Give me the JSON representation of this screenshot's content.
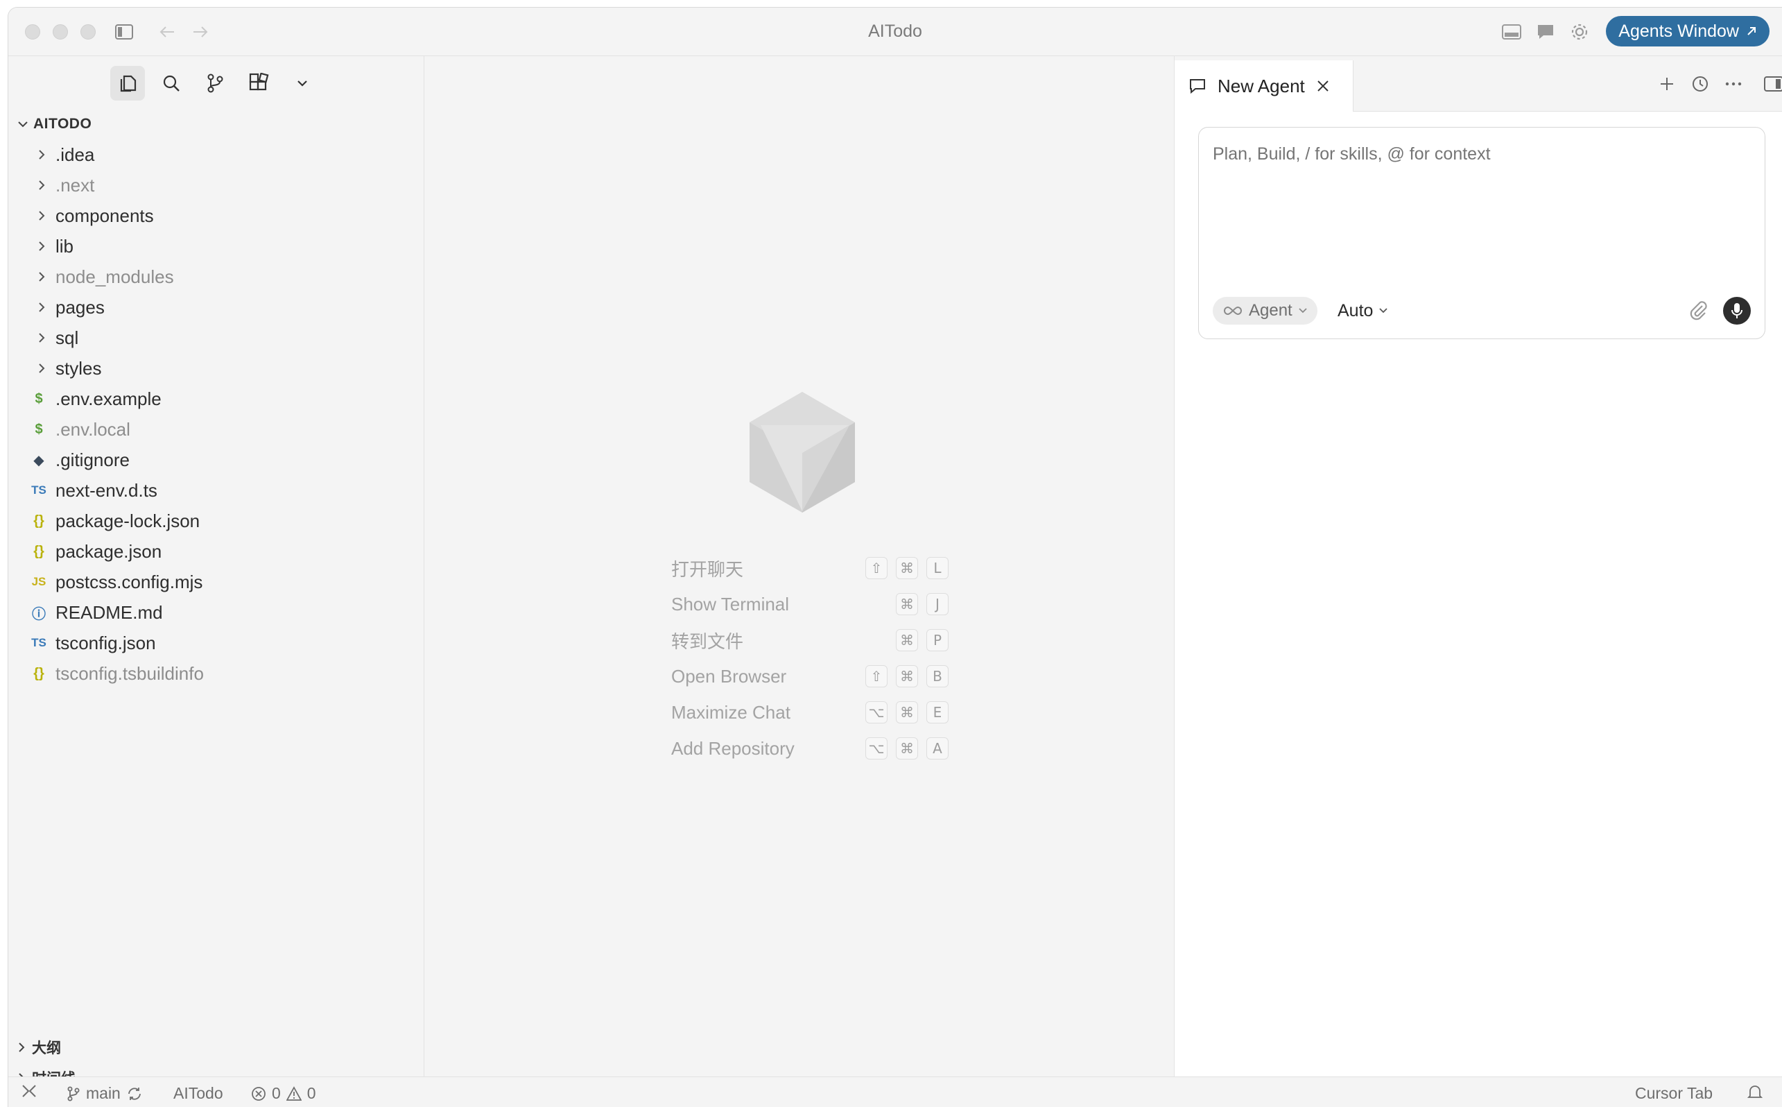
{
  "window": {
    "title": "AITodo"
  },
  "titlebar": {
    "agents_button": "Agents Window"
  },
  "explorer": {
    "root": "AITODO",
    "items": [
      {
        "label": ".idea",
        "kind": "folder",
        "dim": false
      },
      {
        "label": ".next",
        "kind": "folder",
        "dim": true
      },
      {
        "label": "components",
        "kind": "folder",
        "dim": false
      },
      {
        "label": "lib",
        "kind": "folder",
        "dim": false
      },
      {
        "label": "node_modules",
        "kind": "folder",
        "dim": true
      },
      {
        "label": "pages",
        "kind": "folder",
        "dim": false
      },
      {
        "label": "sql",
        "kind": "folder",
        "dim": false
      },
      {
        "label": "styles",
        "kind": "folder",
        "dim": false
      },
      {
        "label": ".env.example",
        "kind": "file",
        "icon": "$",
        "icon_color": "#5a9e3a",
        "dim": false
      },
      {
        "label": ".env.local",
        "kind": "file",
        "icon": "$",
        "icon_color": "#5a9e3a",
        "dim": true
      },
      {
        "label": ".gitignore",
        "kind": "file",
        "icon": "◆",
        "icon_color": "#3b4a5c",
        "dim": false
      },
      {
        "label": "next-env.d.ts",
        "kind": "file",
        "icon": "TS",
        "icon_color": "#3a7ab8",
        "dim": false
      },
      {
        "label": "package-lock.json",
        "kind": "file",
        "icon": "{}",
        "icon_color": "#b9b20b",
        "dim": false
      },
      {
        "label": "package.json",
        "kind": "file",
        "icon": "{}",
        "icon_color": "#b9b20b",
        "dim": false
      },
      {
        "label": "postcss.config.mjs",
        "kind": "file",
        "icon": "JS",
        "icon_color": "#c8b21b",
        "dim": false
      },
      {
        "label": "README.md",
        "kind": "file",
        "icon": "ⓘ",
        "icon_color": "#3a7ab8",
        "dim": false
      },
      {
        "label": "tsconfig.json",
        "kind": "file",
        "icon": "TS",
        "icon_color": "#3a7ab8",
        "dim": false
      },
      {
        "label": "tsconfig.tsbuildinfo",
        "kind": "file",
        "icon": "{}",
        "icon_color": "#b9b20b",
        "dim": true
      }
    ],
    "outline": "大纲",
    "timeline": "时间线"
  },
  "editor": {
    "shortcuts": [
      {
        "label": "打开聊天",
        "keys": [
          "⇧",
          "⌘",
          "L"
        ]
      },
      {
        "label": "Show Terminal",
        "keys": [
          "",
          "⌘",
          "J"
        ]
      },
      {
        "label": "转到文件",
        "keys": [
          "",
          "⌘",
          "P"
        ]
      },
      {
        "label": "Open Browser",
        "keys": [
          "⇧",
          "⌘",
          "B"
        ]
      },
      {
        "label": "Maximize Chat",
        "keys": [
          "⌥",
          "⌘",
          "E"
        ]
      },
      {
        "label": "Add Repository",
        "keys": [
          "⌥",
          "⌘",
          "A"
        ]
      }
    ]
  },
  "agent_panel": {
    "tab_label": "New Agent",
    "placeholder": "Plan, Build, / for skills, @ for context",
    "mode": "Agent",
    "model": "Auto"
  },
  "statusbar": {
    "branch": "main",
    "project": "AITodo",
    "errors": "0",
    "warnings": "0",
    "right_label": "Cursor Tab"
  },
  "colors": {
    "accent": "#2f6ea0"
  }
}
